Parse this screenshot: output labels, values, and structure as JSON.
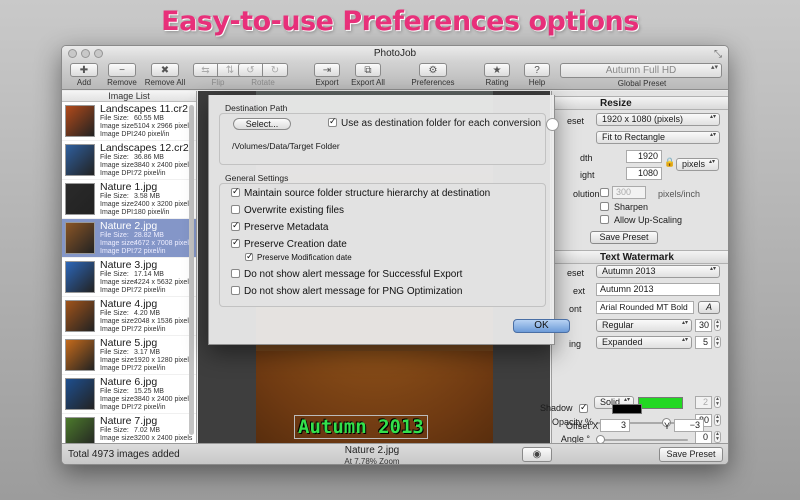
{
  "headline": "Easy-to-use Preferences options",
  "window": {
    "title": "PhotoJob"
  },
  "toolbar": {
    "add": "Add",
    "remove": "Remove",
    "remove_all": "Remove All",
    "flip": "Flip",
    "rotate": "Rotate",
    "export": "Export",
    "export_all": "Export All",
    "preferences": "Preferences",
    "rating": "Rating",
    "help": "Help",
    "preset_value": "Autumn Full HD",
    "preset_label": "Global Preset"
  },
  "image_list": {
    "header": "Image List",
    "meta_labels": {
      "size": "File Size:",
      "dims": "Image size:",
      "dpi": "Image DPI:"
    },
    "items": [
      {
        "name": "Landscapes 11.cr2",
        "size": "60.55 MB",
        "dims": "5104 x 2966 pixels",
        "dpi": "240 pixel/in",
        "thumb": "#b24a1a"
      },
      {
        "name": "Landscapes 12.cr2",
        "size": "36.86 MB",
        "dims": "3840 x 2400 pixels",
        "dpi": "72 pixel/in",
        "thumb": "#2f5f9e"
      },
      {
        "name": "Nature 1.jpg",
        "size": "3.58 MB",
        "dims": "2400 x 3200 pixels",
        "dpi": "180 pixel/in",
        "thumb": "#2a2a2a"
      },
      {
        "name": "Nature 2.jpg",
        "size": "28.82 MB",
        "dims": "4672 x 7008 pixels",
        "dpi": "72 pixel/in",
        "thumb": "#8a5526"
      },
      {
        "name": "Nature 3.jpg",
        "size": "17.14 MB",
        "dims": "4224 x 5632 pixels",
        "dpi": "72 pixel/in",
        "thumb": "#2c66b8"
      },
      {
        "name": "Nature 4.jpg",
        "size": "4.20 MB",
        "dims": "2048 x 1536 pixels",
        "dpi": "72 pixel/in",
        "thumb": "#a0531a"
      },
      {
        "name": "Nature 5.jpg",
        "size": "3.17 MB",
        "dims": "1920 x 1280 pixels",
        "dpi": "72 pixel/in",
        "thumb": "#c46a1b"
      },
      {
        "name": "Nature 6.jpg",
        "size": "15.25 MB",
        "dims": "3840 x 2400 pixels",
        "dpi": "72 pixel/in",
        "thumb": "#1e4f8f"
      },
      {
        "name": "Nature 7.jpg",
        "size": "7.02 MB",
        "dims": "3200 x 2400 pixels",
        "dpi": "72 pixel/in",
        "thumb": "#4c7a2c"
      }
    ]
  },
  "preview": {
    "watermark_text": "Autumn 2013",
    "file_name": "Nature 2.jpg",
    "zoom_text": "At 7.78% Zoom"
  },
  "statusbar": {
    "total": "Total 4973 images added",
    "save_preset": "Save Preset"
  },
  "resize": {
    "header": "Resize",
    "preset_label": "eset",
    "preset_value": "1920 x 1080 (pixels)",
    "mode_value": "Fit to Rectangle",
    "width_label": "dth",
    "width": "1920",
    "height_label": "ight",
    "height": "1080",
    "unit": "pixels",
    "resolution_label": "olution",
    "resolution": "300",
    "resolution_unit": "pixels/inch",
    "sharpen": "Sharpen",
    "upscale": "Allow Up-Scaling",
    "save_preset": "Save Preset"
  },
  "watermark": {
    "header": "Text Watermark",
    "preset_label": "eset",
    "preset_value": "Autumn 2013",
    "text_label": "ext",
    "text_value": "Autumn 2013",
    "font_label": "ont",
    "font_value": "Arial Rounded MT Bold",
    "font_button": "A",
    "style_value": "Regular",
    "font_size": "30",
    "spacing_label": "ing",
    "spacing_value": "Expanded",
    "spacing_num": "5",
    "fill_label": "Fill",
    "fill_value": "Solid",
    "fill_color": "#22d822",
    "fill_num": "2",
    "opacity_label": "Opacity %",
    "opacity_value": "80",
    "opacity_level": 0.8,
    "angle_label": "Angle °",
    "angle_value": "0",
    "shadow_label": "Shadow",
    "shadow_color": "#000000",
    "offset_x_label": "Offset X",
    "offset_x": "3",
    "offset_y_label": "Y",
    "offset_y": "−3"
  },
  "dialog": {
    "dest_section": "Destination Path",
    "select_button": "Select...",
    "use_dest": "Use as destination folder for each conversion",
    "folder_path": "/Volumes/Data/Target Folder",
    "general_section": "General Settings",
    "opt_maintain": "Maintain source folder structure hierarchy at destination",
    "opt_overwrite": "Overwrite existing files",
    "opt_metadata": "Preserve Metadata",
    "opt_creation": "Preserve Creation date",
    "opt_modification": "Preserve Modification date",
    "opt_alert_success": "Do not show alert message for Successful Export",
    "opt_alert_png": "Do not show alert message for PNG Optimization",
    "ok": "OK"
  },
  "colors": {
    "headline": "#e8307a",
    "selection": "#8496c8",
    "ok_button": "#6c9bd8"
  }
}
